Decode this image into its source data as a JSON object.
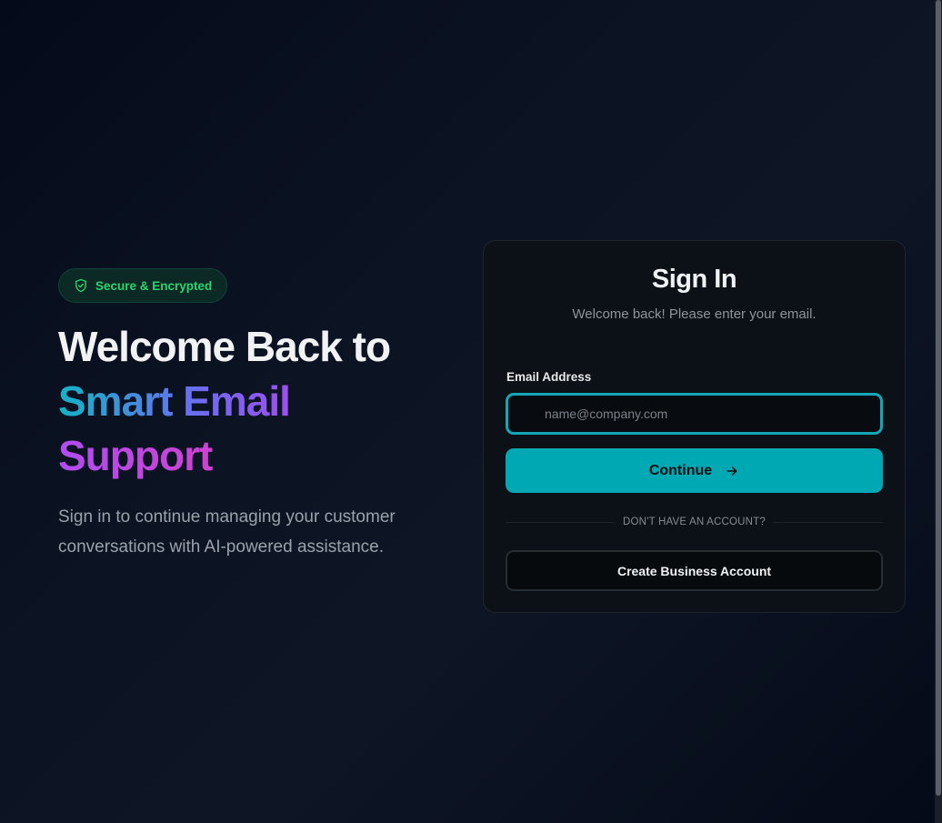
{
  "hero": {
    "badge": "Secure & Encrypted",
    "badge_icon": "shield-check-icon",
    "title_line1": "Welcome Back to",
    "title_line2": "Smart Email",
    "title_line3": "Support",
    "subtitle": "Sign in to continue managing your customer conversations with AI-powered assistance."
  },
  "card": {
    "title": "Sign In",
    "subtitle": "Welcome back! Please enter your email.",
    "email_label": "Email Address",
    "email_placeholder": "name@company.com",
    "email_value": "",
    "continue_label": "Continue",
    "divider_text": "DON'T HAVE AN ACCOUNT?",
    "create_label": "Create Business Account"
  },
  "colors": {
    "accent": "#00a8b4",
    "badge_text": "#2bd46f",
    "card_bg": "#0b1116",
    "focus_border": "#13a7b7"
  }
}
